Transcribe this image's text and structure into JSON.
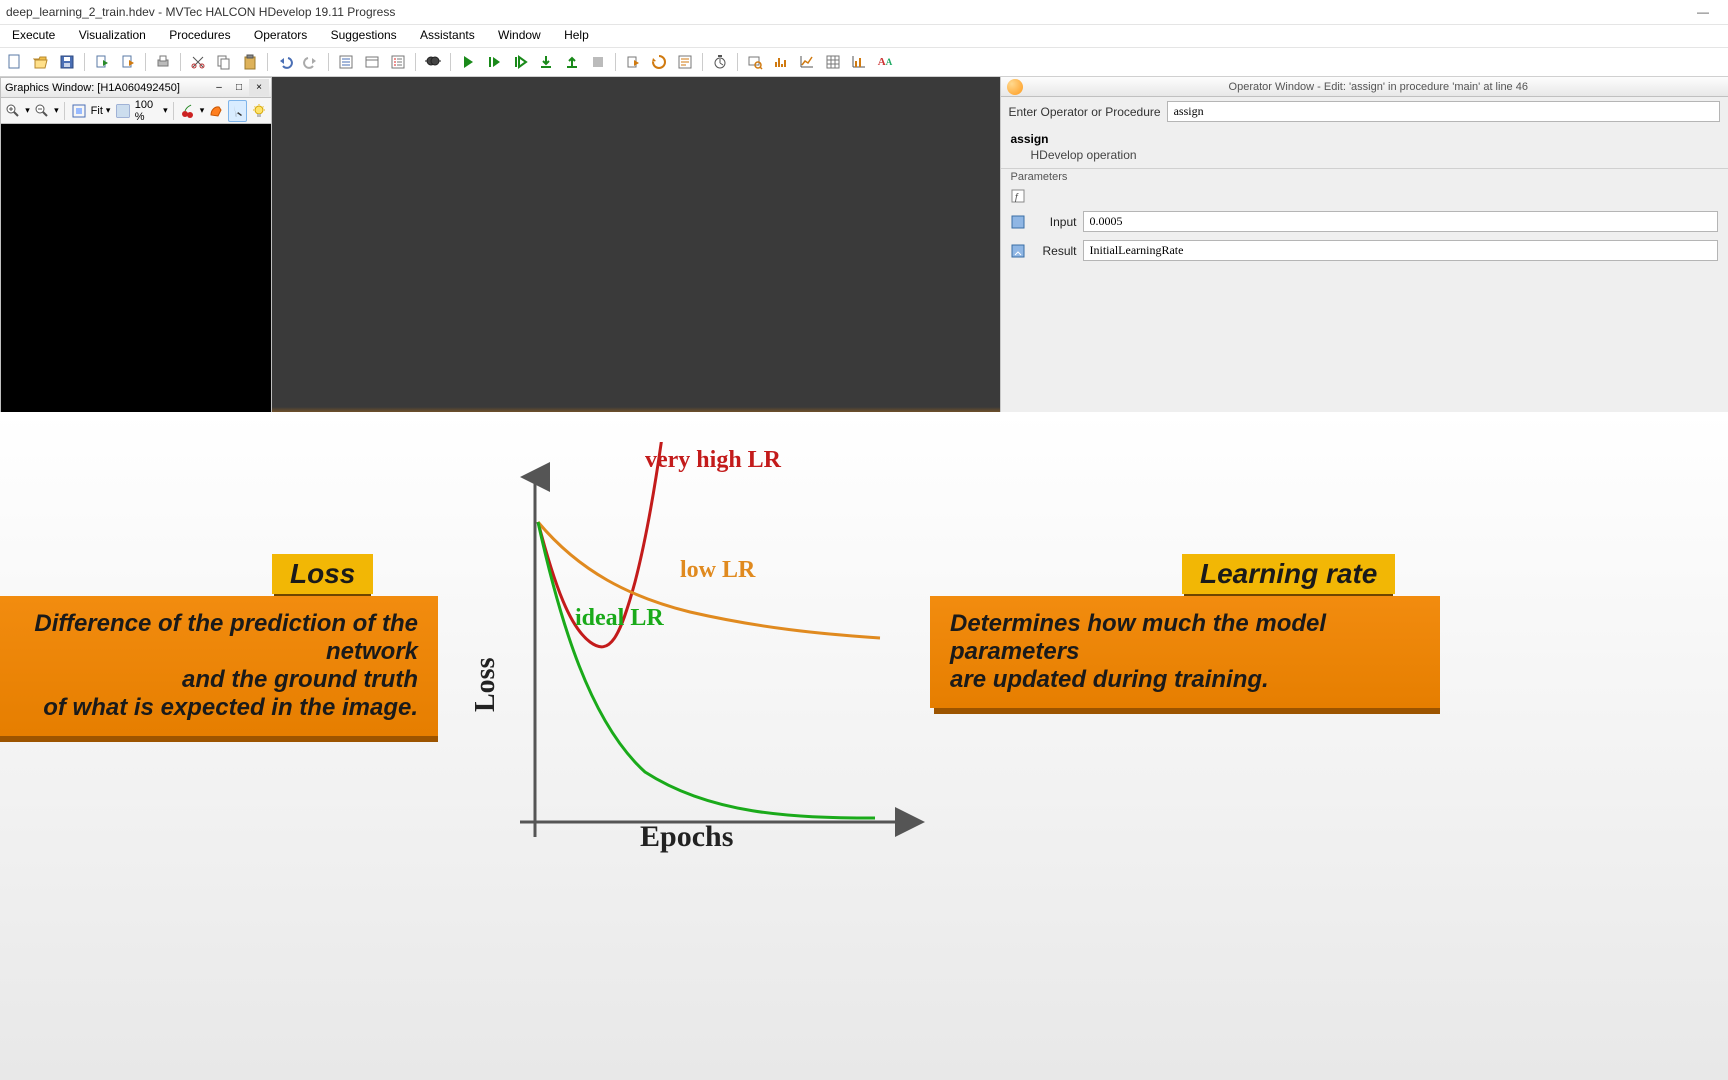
{
  "window": {
    "title": "deep_learning_2_train.hdev - MVTec HALCON HDevelop 19.11 Progress"
  },
  "menu": {
    "items": [
      "Execute",
      "Visualization",
      "Procedures",
      "Operators",
      "Suggestions",
      "Assistants",
      "Window",
      "Help"
    ]
  },
  "graphics_window": {
    "title": "Graphics Window: [H1A060492450]",
    "zoom_text": "100 %",
    "fit_label": "Fit"
  },
  "operator_window": {
    "title": "Operator Window - Edit: 'assign' in procedure 'main' at line 46",
    "enter_label": "Enter Operator or Procedure",
    "enter_value": "assign",
    "op_name": "assign",
    "op_desc": "HDevelop operation",
    "parameters_label": "Parameters",
    "input_label": "Input",
    "input_value": "0.0005",
    "result_label": "Result",
    "result_value": "InitialLearningRate"
  },
  "edu": {
    "loss_tag": "Loss",
    "loss_desc_l1": "Difference of the prediction of the network",
    "loss_desc_l2": "and the ground truth",
    "loss_desc_l3": "of what is expected in the image.",
    "lr_tag": "Learning rate",
    "lr_desc_l1": "Determines how much the model parameters",
    "lr_desc_l2": "are updated during training.",
    "label_very_high": "very high LR",
    "label_low": "low LR",
    "label_ideal": "ideal LR",
    "xlabel": "Epochs",
    "ylabel": "Loss"
  },
  "chart_data": {
    "type": "line",
    "title": "Loss vs Epochs for different learning rates",
    "xlabel": "Epochs",
    "ylabel": "Loss",
    "xlim": [
      0,
      10
    ],
    "ylim": [
      0,
      10
    ],
    "series": [
      {
        "name": "very high LR",
        "color": "#c31b1b",
        "x": [
          0,
          0.5,
          1,
          1.5,
          2,
          2.5,
          3,
          3.5,
          4
        ],
        "values": [
          8.5,
          6.8,
          6.2,
          6.5,
          7.3,
          8.4,
          9.6,
          10.8,
          12
        ]
      },
      {
        "name": "low LR",
        "color": "#e08a1f",
        "x": [
          0,
          1,
          2,
          3,
          4,
          5,
          6,
          7,
          8,
          9,
          10
        ],
        "values": [
          8.5,
          7.4,
          6.6,
          6.0,
          5.6,
          5.3,
          5.1,
          5.0,
          4.9,
          4.85,
          4.8
        ]
      },
      {
        "name": "ideal LR",
        "color": "#1aaa1a",
        "x": [
          0,
          1,
          2,
          3,
          4,
          5,
          6,
          7,
          8,
          9,
          10
        ],
        "values": [
          8.5,
          5.5,
          3.6,
          2.4,
          1.6,
          1.1,
          0.8,
          0.6,
          0.5,
          0.45,
          0.4
        ]
      }
    ]
  }
}
